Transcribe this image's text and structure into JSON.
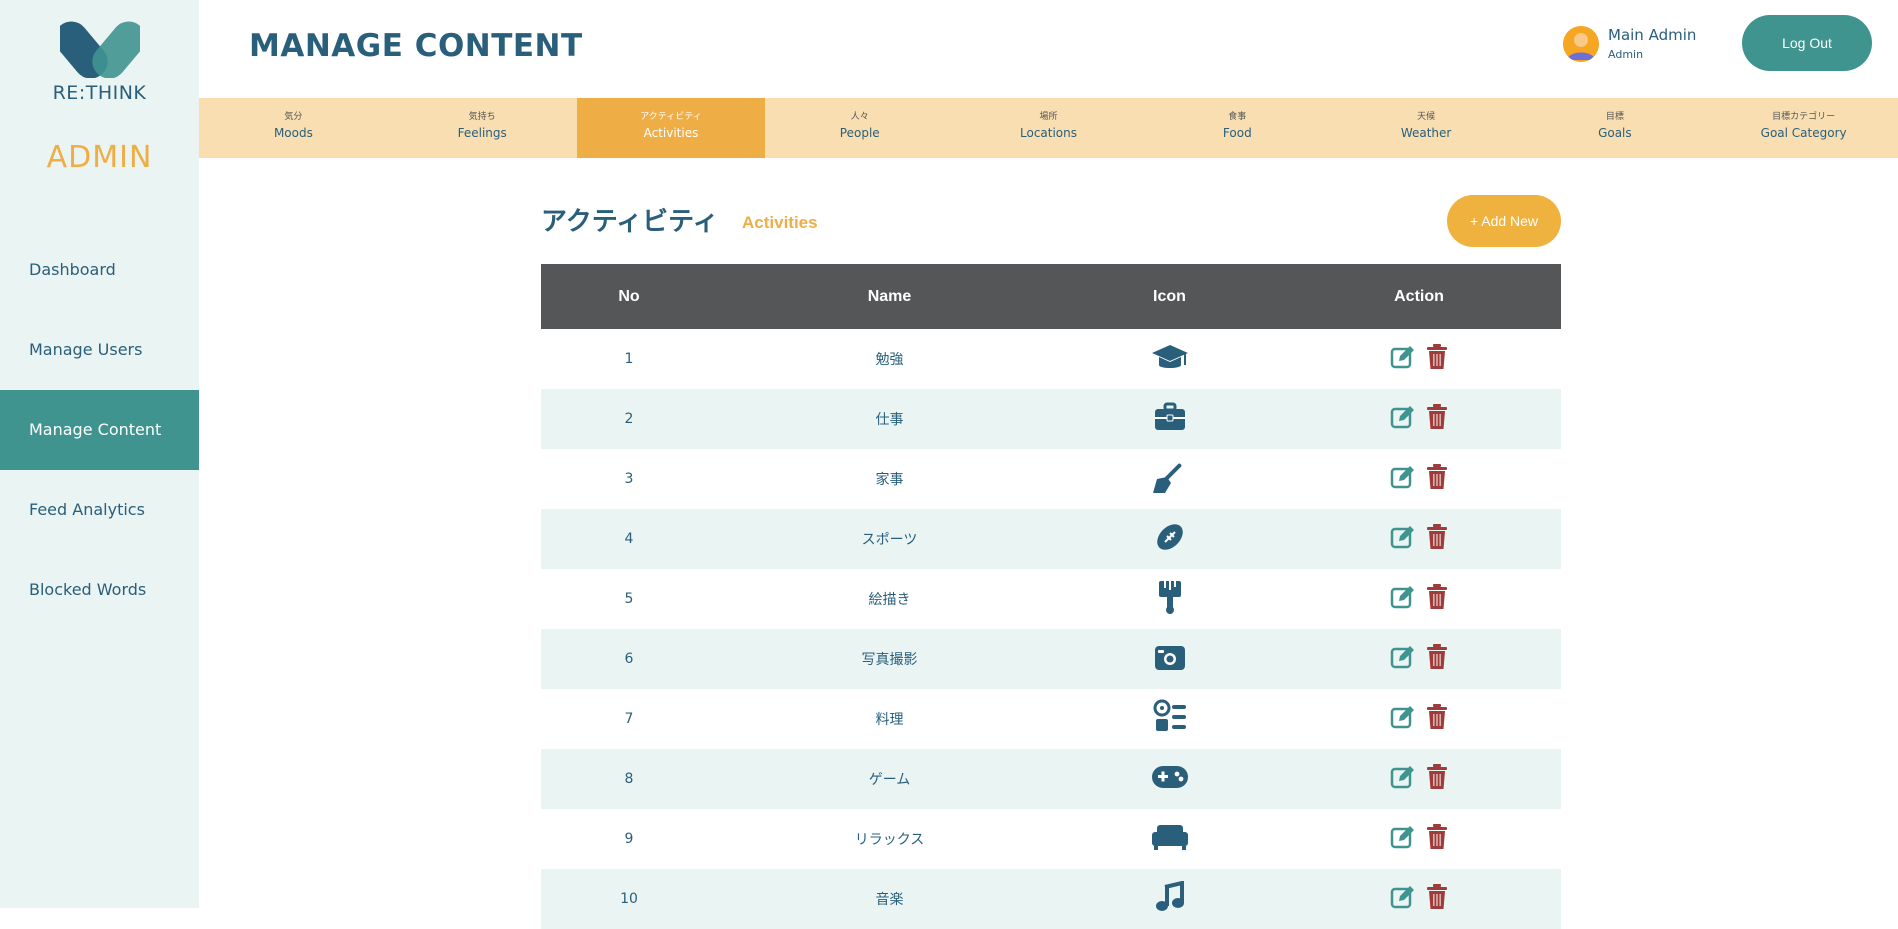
{
  "brand": {
    "name": "RE:THINK",
    "role_title": "ADMIN"
  },
  "sidebar": {
    "items": [
      {
        "label": "Dashboard",
        "active": false
      },
      {
        "label": "Manage Users",
        "active": false
      },
      {
        "label": "Manage Content",
        "active": true
      },
      {
        "label": "Feed Analytics",
        "active": false
      },
      {
        "label": "Blocked Words",
        "active": false
      }
    ]
  },
  "header": {
    "title": "MANAGE CONTENT",
    "user": {
      "name": "Main Admin",
      "role": "Admin"
    },
    "logout_label": "Log Out"
  },
  "tabs": [
    {
      "jp": "気分",
      "en": "Moods",
      "active": false
    },
    {
      "jp": "気持ち",
      "en": "Feelings",
      "active": false
    },
    {
      "jp": "アクティビティ",
      "en": "Activities",
      "active": true
    },
    {
      "jp": "人々",
      "en": "People",
      "active": false
    },
    {
      "jp": "場所",
      "en": "Locations",
      "active": false
    },
    {
      "jp": "食事",
      "en": "Food",
      "active": false
    },
    {
      "jp": "天候",
      "en": "Weather",
      "active": false
    },
    {
      "jp": "目標",
      "en": "Goals",
      "active": false
    },
    {
      "jp": "目標カテゴリー",
      "en": "Goal Category",
      "active": false
    }
  ],
  "section": {
    "title_jp": "アクティビティ",
    "title_en": "Activities",
    "add_label": "+ Add New"
  },
  "table": {
    "columns": [
      "No",
      "Name",
      "Icon",
      "Action"
    ],
    "rows": [
      {
        "no": "1",
        "name": "勉強",
        "icon": "graduation-cap-icon"
      },
      {
        "no": "2",
        "name": "仕事",
        "icon": "briefcase-icon"
      },
      {
        "no": "3",
        "name": "家事",
        "icon": "broom-icon"
      },
      {
        "no": "4",
        "name": "スポーツ",
        "icon": "football-icon"
      },
      {
        "no": "5",
        "name": "絵描き",
        "icon": "paint-brush-icon"
      },
      {
        "no": "6",
        "name": "写真撮影",
        "icon": "camera-icon"
      },
      {
        "no": "7",
        "name": "料理",
        "icon": "kitchen-icon"
      },
      {
        "no": "8",
        "name": "ゲーム",
        "icon": "gamepad-icon"
      },
      {
        "no": "9",
        "name": "リラックス",
        "icon": "couch-icon"
      },
      {
        "no": "10",
        "name": "音楽",
        "icon": "music-icon"
      }
    ]
  },
  "colors": {
    "primary_teal": "#3f9490",
    "accent_orange": "#efae45",
    "text_navy": "#2a5f7c",
    "delete_red": "#9e3b3b",
    "tab_bar": "#f8deb1",
    "table_header": "#545657"
  }
}
